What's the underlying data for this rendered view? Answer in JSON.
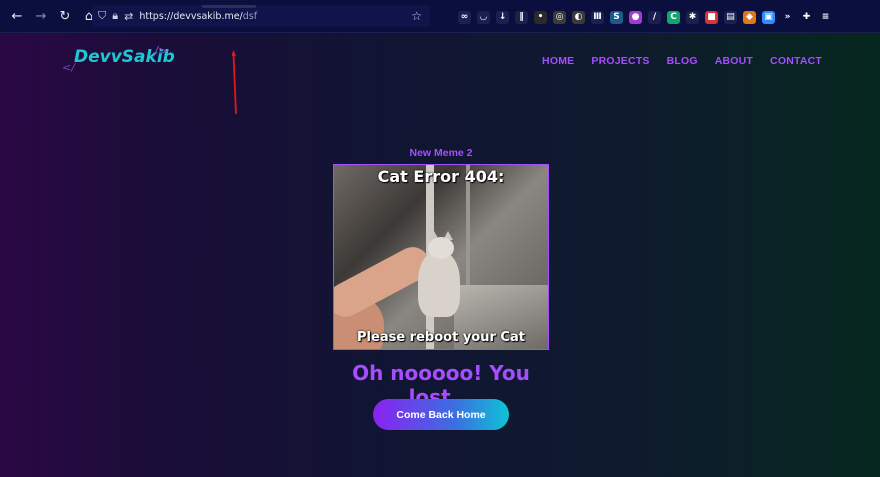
{
  "browser": {
    "url_host": "https://devvsakib.me/",
    "url_path": "dsf",
    "back_icon": "arrow-left-icon",
    "forward_icon": "arrow-right-icon",
    "reload_icon": "reload-icon",
    "home_icon": "home-icon",
    "bookmark_icon": "star-icon",
    "extensions": [
      {
        "name": "infinity-icon",
        "glyph": "∞",
        "color": "#1c2050"
      },
      {
        "name": "pocket-icon",
        "glyph": "◡",
        "color": "#1c2050"
      },
      {
        "name": "download-icon",
        "glyph": "↓",
        "color": "#1c2050"
      },
      {
        "name": "library-icon",
        "glyph": "‖",
        "color": "#1c2050"
      },
      {
        "name": "extension-a-icon",
        "glyph": "•",
        "color": "#2a2a2a"
      },
      {
        "name": "extension-b-icon",
        "glyph": "◎",
        "color": "#3a3a3a"
      },
      {
        "name": "extension-c-icon",
        "glyph": "◐",
        "color": "#3a3a3a"
      },
      {
        "name": "extension-d-icon",
        "glyph": "Ⅲ",
        "color": "#1c2050"
      },
      {
        "name": "extension-s-icon",
        "glyph": "S",
        "color": "#1c5a8a"
      },
      {
        "name": "extension-purple-icon",
        "glyph": "●",
        "color": "#a23bd6"
      },
      {
        "name": "extension-pen-icon",
        "glyph": "/",
        "color": "#1c2050"
      },
      {
        "name": "extension-c2-icon",
        "glyph": "C",
        "color": "#12a56e"
      },
      {
        "name": "extension-gear-icon",
        "glyph": "✱",
        "color": "#1c2050"
      },
      {
        "name": "extension-red-icon",
        "glyph": "■",
        "color": "#d6323a"
      },
      {
        "name": "extension-print-icon",
        "glyph": "▤",
        "color": "#1c2050"
      },
      {
        "name": "extension-fox-icon",
        "glyph": "◆",
        "color": "#e2761b"
      },
      {
        "name": "extension-zoom-icon",
        "glyph": "▣",
        "color": "#2d8cff"
      },
      {
        "name": "overflow-icon",
        "glyph": "»",
        "color": "#0b0f3d"
      },
      {
        "name": "extensions-icon",
        "glyph": "✚",
        "color": "#0b0f3d"
      },
      {
        "name": "menu-icon",
        "glyph": "≡",
        "color": "#0b0f3d"
      }
    ]
  },
  "site": {
    "logo_prefix": "</",
    "logo_name": "DevvSakib",
    "logo_suffix": "/>",
    "nav": [
      "HOME",
      "PROJECTS",
      "BLOG",
      "ABOUT",
      "CONTACT"
    ]
  },
  "main": {
    "meme_caption": "New Meme 2",
    "meme_top_text": "Cat Error 404:",
    "meme_bottom_text": "Please reboot your Cat",
    "headline": "Oh nooooo! You lost...",
    "button_label": "Come Back Home"
  },
  "colors": {
    "accent": "#a64dff",
    "logo": "#1ec8d2",
    "annotation_arrow": "#e01818"
  }
}
